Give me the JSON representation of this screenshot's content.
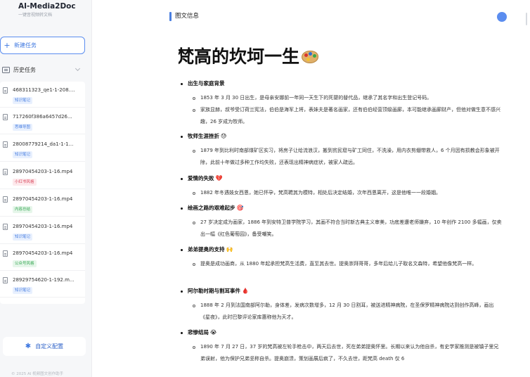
{
  "app": {
    "title": "AI-Media2Doc",
    "subtitle": "一键音视频转文档"
  },
  "sidebar": {
    "new_task_label": "新建任务",
    "history_label": "历史任务",
    "tasks": [
      {
        "name": "468311323_qe1-1-208....",
        "tag": "知识笔记",
        "tag_color": "blue"
      },
      {
        "name": "717260f386a6457d26...",
        "tag": "思维导图",
        "tag_color": "blue"
      },
      {
        "name": "28008779214_da1-1-1...",
        "tag": "知识笔记",
        "tag_color": "blue"
      },
      {
        "name": "28970454203-1-16.mp4",
        "tag": "小红书风格",
        "tag_color": "red"
      },
      {
        "name": "28970454203-1-16.mp4",
        "tag": "内容总结",
        "tag_color": "green"
      },
      {
        "name": "28970454203-1-16.mp4",
        "tag": "知识笔记",
        "tag_color": "blue"
      },
      {
        "name": "28970454203-1-16.mp4",
        "tag": "公众号风格",
        "tag_color": "green"
      },
      {
        "name": "28929754620-1-192.m...",
        "tag": "知识笔记",
        "tag_color": "blue"
      }
    ],
    "custom_config_label": "自定义配置",
    "footer": "© 2025 AI 视频图文创作助手"
  },
  "header": {
    "title": "图文信息",
    "avatar_letter": "●"
  },
  "document": {
    "title": "梵高的坎坷一生",
    "title_icon": "artist-palette-icon",
    "sections": [
      {
        "title": "出生与家庭背景",
        "emoji": "",
        "paras": [
          "1853 年 3 月 30 日出生，是母亲安娜前一年同一天生下的死婴的替代品，继承了其名字和出生登记号码。",
          "家族显赫，叔爷受订荷兰宪法，伯伯是海军上将，表妹夫是著名画家，还有伯伯经营顶级画廊，本可能继承画廊财产，但他对做生意不感兴趣，26 岁成为牧师。"
        ]
      },
      {
        "title": "牧师生涯挫折",
        "emoji": "😓",
        "paras": [
          "1879 年到比利时南部煤矿区实习，将房子让给流浪汉，搬到贫民窟与矿工同住，不洗澡，用内衣剪绷带救人，6 个月因有损教会形象被开除，此前十年做过多种工作均失败，还表现出精神病症状，被家人疏远。"
        ]
      },
      {
        "title": "爱情的失败",
        "emoji": "💔",
        "paras": [
          "1882 年冬遇妓女西恩，她已怀孕，梵高聘其为模特，相处后决定结婚，次年西恩离开，这是他唯一一段婚姻。"
        ]
      },
      {
        "title": "绘画之路的艰难起步",
        "emoji": "🎯",
        "paras": [
          "27 岁决定成为画家，1886 年到安特卫普学院学习，其画不符合当时新古典主义审美，功底差遭老师嫌弃，10 年创作 2100 多幅画，仅卖出一幅《红色葡萄园》，备受嘲笑。"
        ]
      },
      {
        "title": "弟弟提奥的支持",
        "emoji": "🙌",
        "paras": [
          "提奥是成功画商，从 1880 年起承担梵高生活费，直至其去世。提奥崇拜哥哥，多年后给儿子取名文森特，希望他像梵高一样。"
        ]
      },
      {
        "title": "阿尔勒时期与割耳事件",
        "emoji": "🩸",
        "paras": [
          "1888 年 2 月到法国南部阿尔勒，身体差，发病次数增多，12 月 30 日割耳，被送进精神病院，在圣保罗精神病院达到创作高峰，画出《星夜》，此时巴黎评论家库惠称他为天才。"
        ]
      },
      {
        "title": "悲惨结局",
        "emoji": "😭",
        "paras": [
          "1890 年 7 月 27 日，37 岁的梵高被左轮手枪击中，两天后去世，死在弟弟提奥怀里。长期以来认为他自杀，有史学家推测是被镇子里兄弟误射，他为保护兄弟坚称自杀。提奥崩溃，策划画展后疯了，不久去世，距梵高 death 仅 6"
        ]
      }
    ]
  }
}
